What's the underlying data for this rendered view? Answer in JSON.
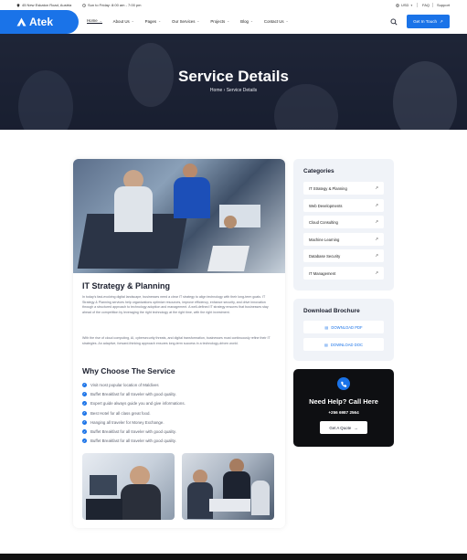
{
  "topbar": {
    "address": "45 New Eskaton Road, Austria",
    "hours": "Sun to Friday: 8:00 am - 7:00 pm",
    "currency": "USD",
    "faq": "FAQ",
    "support": "Support"
  },
  "header": {
    "logo": "Atek",
    "nav": [
      {
        "label": "Home",
        "has_dropdown": true
      },
      {
        "label": "About Us",
        "has_dropdown": true
      },
      {
        "label": "Pages",
        "has_dropdown": true
      },
      {
        "label": "Our Services",
        "has_dropdown": true
      },
      {
        "label": "Projects",
        "has_dropdown": true
      },
      {
        "label": "Blog",
        "has_dropdown": true
      },
      {
        "label": "Contact Us",
        "has_dropdown": true
      }
    ],
    "cta_label": "Get In Touch"
  },
  "hero": {
    "title": "Service Details",
    "breadcrumb_home": "Home",
    "breadcrumb_current": "Service Details"
  },
  "main": {
    "title": "IT Strategy & Planning",
    "paragraph_1": "In today's fast-evolving digital landscape, businesses need a clear IT strategy to align technology with their long-term goals. IT Strategy & Planning services help organizations optimize resources, improve efficiency, enhance security, and drive innovation through a structured approach to technology adoption and management. A well-defined IT strategy ensures that businesses stay ahead of the competition by leveraging the right technology at the right time, with the right investment.",
    "paragraph_2": "With the rise of cloud computing, AI, cybersecurity threats, and digital transformation, businesses must continuously refine their IT strategies. An adaptive, forward-thinking approach ensures long-term success in a technology-driven world.",
    "why_title": "Why Choose The Service",
    "checklist": [
      "Visit most popular location of Maldives",
      "Buffet Breakfast for all traveler with good quality.",
      "Expert guide always guide you and give informations.",
      "Best Hotel for all class great food.",
      "Hanging all traveler for Money Exchange.",
      "Buffet Breakfast for all traveler with good quality.",
      "Buffet Breakfast for all traveler with good quality."
    ]
  },
  "sidebar": {
    "categories_title": "Categories",
    "categories": [
      "IT Strategy & Planning",
      "Web Developments",
      "Cloud Consulting",
      "Machine Learning",
      "Database Security",
      "IT Management"
    ],
    "brochure_title": "Download Brochure",
    "downloads": [
      "DOWNLOAD PDF",
      "DOWNLOAD DOC"
    ],
    "help_title": "Need Help? Call Here",
    "help_phone": "+256 6987 2564",
    "quote_label": "Get A Quote"
  },
  "colors": {
    "accent": "#1a73e8",
    "dark": "#0e0f12",
    "sidebar_bg": "#f0f3f8"
  }
}
